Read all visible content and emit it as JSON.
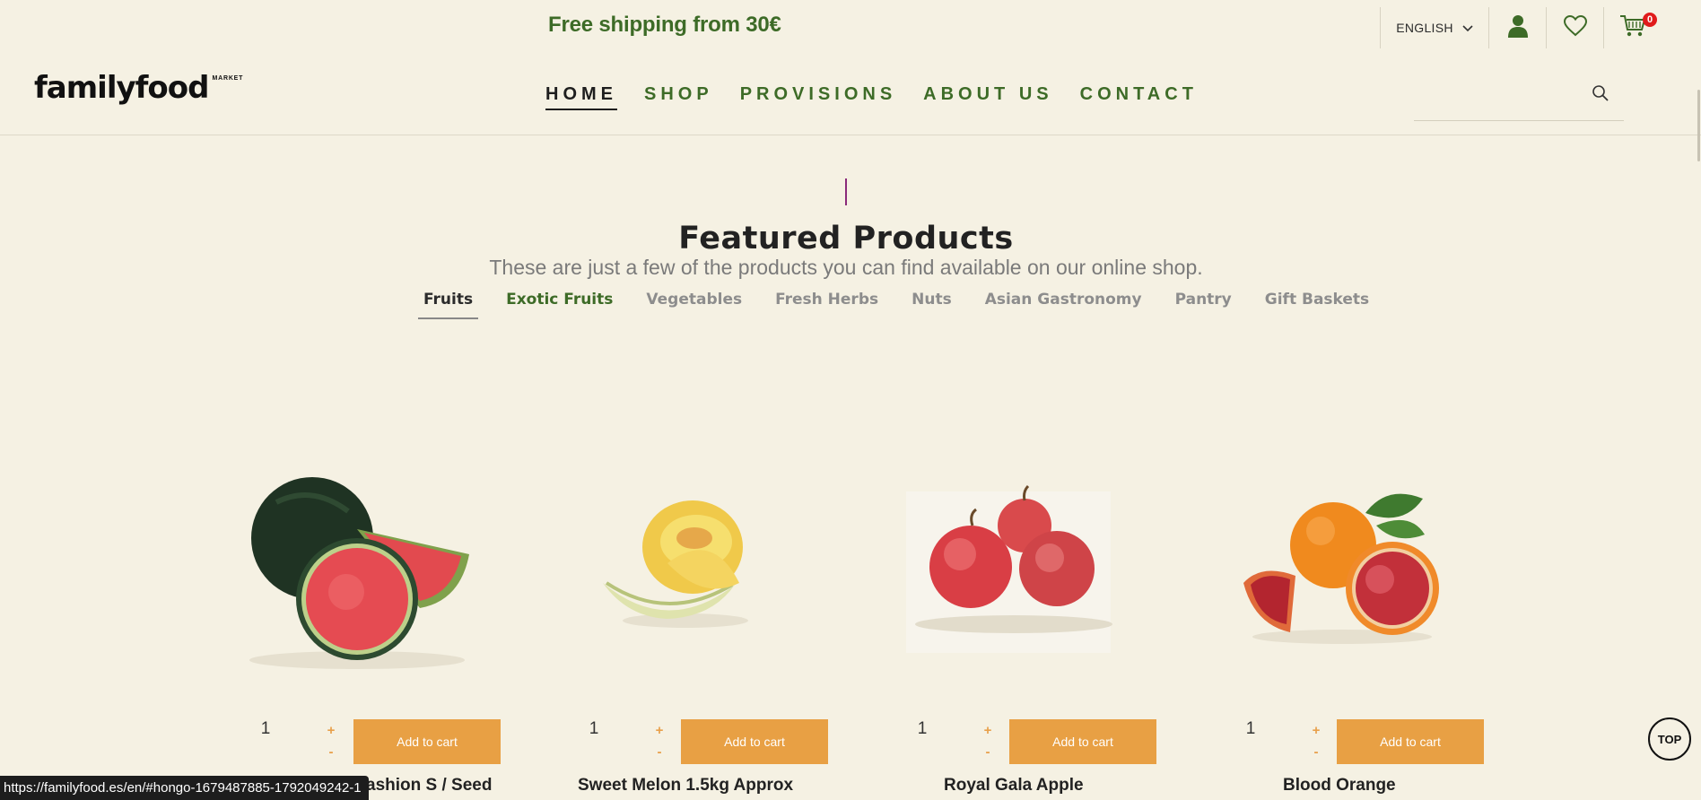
{
  "header": {
    "promo": "Free shipping from 30€",
    "language": "ENGLISH",
    "cart_count": "0",
    "logo": {
      "word": "familyfood",
      "sup": "MARKET"
    },
    "nav": [
      {
        "label": "HOME",
        "active": true
      },
      {
        "label": "SHOP",
        "active": false
      },
      {
        "label": "PROVISIONS",
        "active": false
      },
      {
        "label": "ABOUT US",
        "active": false
      },
      {
        "label": "CONTACT",
        "active": false
      }
    ],
    "search": {
      "value": "",
      "placeholder": ""
    }
  },
  "featured": {
    "title": "Featured Products",
    "subtitle": "These are just a few of the products you can find available on our online shop.",
    "categories": [
      "Fruits",
      "Exotic Fruits",
      "Vegetables",
      "Fresh Herbs",
      "Nuts",
      "Asian Gastronomy",
      "Pantry",
      "Gift Baskets"
    ],
    "active_category": "Fruits"
  },
  "products": [
    {
      "name": "ashion S / Seed",
      "qty": "1",
      "add_label": "Add to cart",
      "image": "watermelon"
    },
    {
      "name": "Sweet Melon 1.5kg Approx",
      "qty": "1",
      "add_label": "Add to cart",
      "image": "melon"
    },
    {
      "name": "Royal Gala Apple",
      "qty": "1",
      "add_label": "Add to cart",
      "image": "apples"
    },
    {
      "name": "Blood Orange",
      "qty": "1",
      "add_label": "Add to cart",
      "image": "blood-orange"
    }
  ],
  "qty_controls": {
    "plus": "+",
    "minus": "-"
  },
  "top_button": "TOP",
  "status_url": "https://familyfood.es/en/#hongo-1679487885-1792049242-1",
  "colors": {
    "background": "#f5f1e3",
    "brand_green": "#3d6b27",
    "accent_orange": "#e8a044",
    "badge_red": "#e01b1b"
  }
}
